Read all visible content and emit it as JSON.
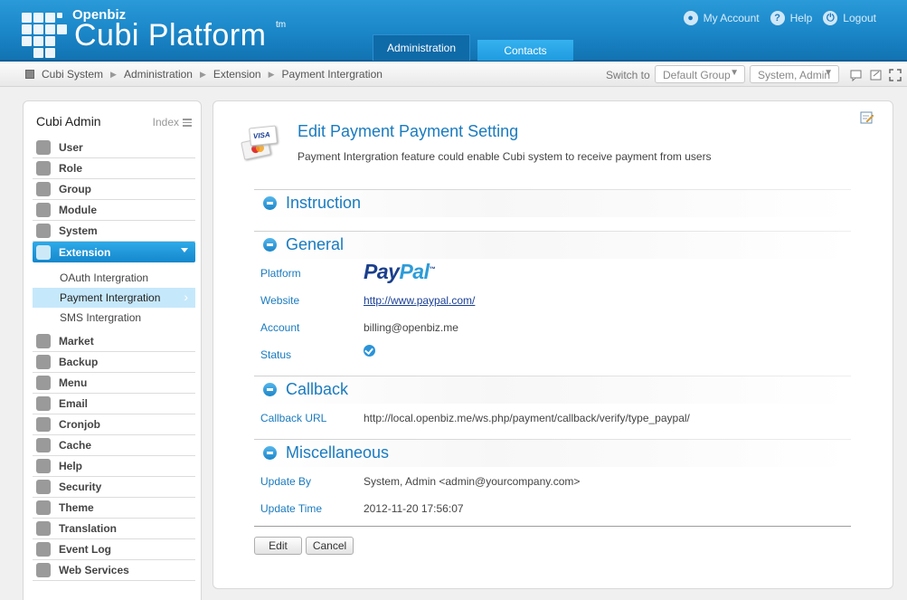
{
  "header": {
    "logo_small": "Openbiz",
    "logo_big": "Cubi Platform",
    "logo_tm": "tm",
    "nav": [
      {
        "label": "My Account",
        "icon": "user-icon"
      },
      {
        "label": "Help",
        "icon": "help-icon"
      },
      {
        "label": "Logout",
        "icon": "power-icon"
      }
    ],
    "tabs": [
      {
        "label": "Administration",
        "active": true
      },
      {
        "label": "Contacts",
        "active": false
      }
    ]
  },
  "breadcrumb": {
    "items": [
      "Cubi System",
      "Administration",
      "Extension",
      "Payment Intergration"
    ],
    "switch_label": "Switch to",
    "group_select": "Default Group",
    "user_select": "System, Admin"
  },
  "sidebar": {
    "title": "Cubi Admin",
    "index_label": "Index",
    "items": [
      {
        "label": "User",
        "icon": "user-icon"
      },
      {
        "label": "Role",
        "icon": "key-icon"
      },
      {
        "label": "Group",
        "icon": "group-icon"
      },
      {
        "label": "Module",
        "icon": "module-icon"
      },
      {
        "label": "System",
        "icon": "gear-icon"
      },
      {
        "label": "Extension",
        "icon": "puzzle-icon",
        "active": true
      },
      {
        "label": "Market",
        "icon": "market-icon"
      },
      {
        "label": "Backup",
        "icon": "backup-icon"
      },
      {
        "label": "Menu",
        "icon": "menu-icon"
      },
      {
        "label": "Email",
        "icon": "email-icon"
      },
      {
        "label": "Cronjob",
        "icon": "clock-icon"
      },
      {
        "label": "Cache",
        "icon": "cache-icon"
      },
      {
        "label": "Help",
        "icon": "help-icon"
      },
      {
        "label": "Security",
        "icon": "shield-icon"
      },
      {
        "label": "Theme",
        "icon": "theme-icon"
      },
      {
        "label": "Translation",
        "icon": "translation-icon"
      },
      {
        "label": "Event Log",
        "icon": "log-icon"
      },
      {
        "label": "Web Services",
        "icon": "globe-icon"
      }
    ],
    "subitems": [
      {
        "label": "OAuth Intergration"
      },
      {
        "label": "Payment Intergration",
        "active": true
      },
      {
        "label": "SMS Intergration"
      }
    ]
  },
  "main": {
    "title": "Edit Payment Payment Setting",
    "description": "Payment Intergration feature could enable Cubi system to receive payment from users",
    "sections": {
      "instruction": "Instruction",
      "general": "General",
      "callback": "Callback",
      "misc": "Miscellaneous"
    },
    "fields": {
      "platform_label": "Platform",
      "platform_logo_a": "Pay",
      "platform_logo_b": "Pal",
      "platform_logo_tm": "™",
      "website_label": "Website",
      "website_value": "http://www.paypal.com/",
      "account_label": "Account",
      "account_value": "billing@openbiz.me",
      "status_label": "Status",
      "callback_label": "Callback URL",
      "callback_value": "http://local.openbiz.me/ws.php/payment/callback/verify/type_paypal/",
      "update_by_label": "Update By",
      "update_by_value": "System, Admin <admin@yourcompany.com>",
      "update_time_label": "Update Time",
      "update_time_value": "2012-11-20 17:56:07"
    },
    "buttons": {
      "edit": "Edit",
      "cancel": "Cancel"
    }
  },
  "colors": {
    "brand_blue": "#1a86c8",
    "link_blue": "#1a7bbf",
    "active_blue": "#1487cc"
  }
}
